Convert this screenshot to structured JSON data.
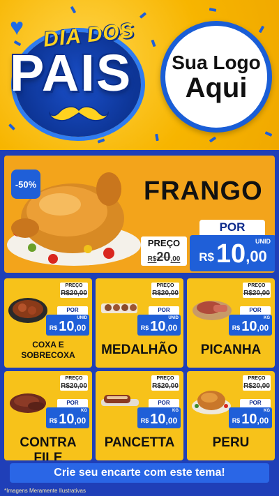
{
  "header": {
    "title_top": "DIA DOS",
    "title_main": "PAIS",
    "logo_line1": "Sua Logo",
    "logo_line2": "Aqui"
  },
  "hero": {
    "discount": "-50%",
    "name": "FRANGO",
    "preco_label": "PREÇO",
    "old_price_currency": "R$",
    "old_price": "20",
    "old_price_cents": ",00",
    "por_label": "POR",
    "unit": "UNID",
    "new_price_currency": "R$",
    "new_price": "10",
    "new_price_cents": ",00"
  },
  "products": [
    {
      "name": "COXA E SOBRECOXA",
      "preco_label": "PREÇO",
      "old_price": "R$20,00",
      "por_label": "POR",
      "unit": "UNID",
      "currency": "R$",
      "price": "10",
      "cents": ",00"
    },
    {
      "name": "MEDALHÃO",
      "preco_label": "PREÇO",
      "old_price": "R$20,00",
      "por_label": "POR",
      "unit": "UNID",
      "currency": "R$",
      "price": "10",
      "cents": ",00"
    },
    {
      "name": "PICANHA",
      "preco_label": "PREÇO",
      "old_price": "R$20,00",
      "por_label": "POR",
      "unit": "KG",
      "currency": "R$",
      "price": "10",
      "cents": ",00"
    },
    {
      "name": "CONTRA FILE",
      "preco_label": "PREÇO",
      "old_price": "R$20,00",
      "por_label": "POR",
      "unit": "KG",
      "currency": "R$",
      "price": "10",
      "cents": ",00"
    },
    {
      "name": "PANCETTA",
      "preco_label": "PREÇO",
      "old_price": "R$20,00",
      "por_label": "POR",
      "unit": "KG",
      "currency": "R$",
      "price": "10",
      "cents": ",00"
    },
    {
      "name": "PERU",
      "preco_label": "PREÇO",
      "old_price": "R$20,00",
      "por_label": "POR",
      "unit": "KG",
      "currency": "R$",
      "price": "10",
      "cents": ",00"
    }
  ],
  "cta": "Crie seu encarte com este tema!",
  "disclaimer": "*Imagens Meramente Ilustrativas",
  "colors": {
    "brand_blue": "#1f3fb8",
    "accent_blue": "#1f5fd8",
    "yellow": "#f7c21a",
    "orange": "#f3a41b"
  }
}
